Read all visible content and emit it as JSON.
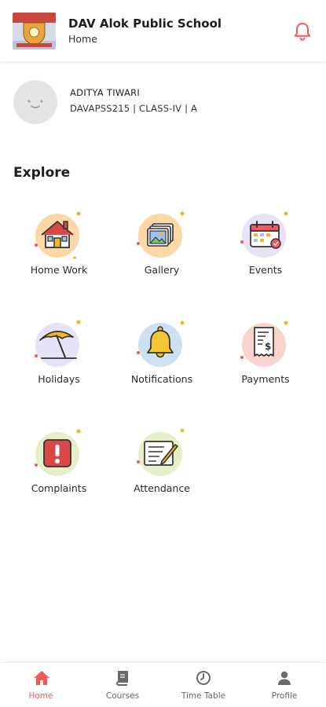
{
  "header": {
    "school_name": "DAV Alok Public School",
    "subtitle": "Home",
    "notification_icon": "bell-icon"
  },
  "profile": {
    "name": "ADITYA TIWARI",
    "meta": "DAVAPSS215 | CLASS-IV | A"
  },
  "explore": {
    "title": "Explore",
    "items": [
      {
        "label": "Home Work",
        "icon": "house-icon"
      },
      {
        "label": "Gallery",
        "icon": "photo-gallery-icon"
      },
      {
        "label": "Events",
        "icon": "calendar-icon"
      },
      {
        "label": "Holidays",
        "icon": "beach-umbrella-icon"
      },
      {
        "label": "Notifications",
        "icon": "bell-icon"
      },
      {
        "label": "Payments",
        "icon": "receipt-icon"
      },
      {
        "label": "Complaints",
        "icon": "alert-icon"
      },
      {
        "label": "Attendance",
        "icon": "notepad-icon"
      }
    ]
  },
  "bottom_nav": {
    "items": [
      {
        "label": "Home",
        "icon": "home-icon",
        "active": true
      },
      {
        "label": "Courses",
        "icon": "book-icon",
        "active": false
      },
      {
        "label": "Time Table",
        "icon": "clock-icon",
        "active": false
      },
      {
        "label": "Profile",
        "icon": "user-icon",
        "active": false
      }
    ]
  },
  "colors": {
    "accent": "#f05a5a",
    "text": "#222222",
    "muted": "#666666"
  }
}
